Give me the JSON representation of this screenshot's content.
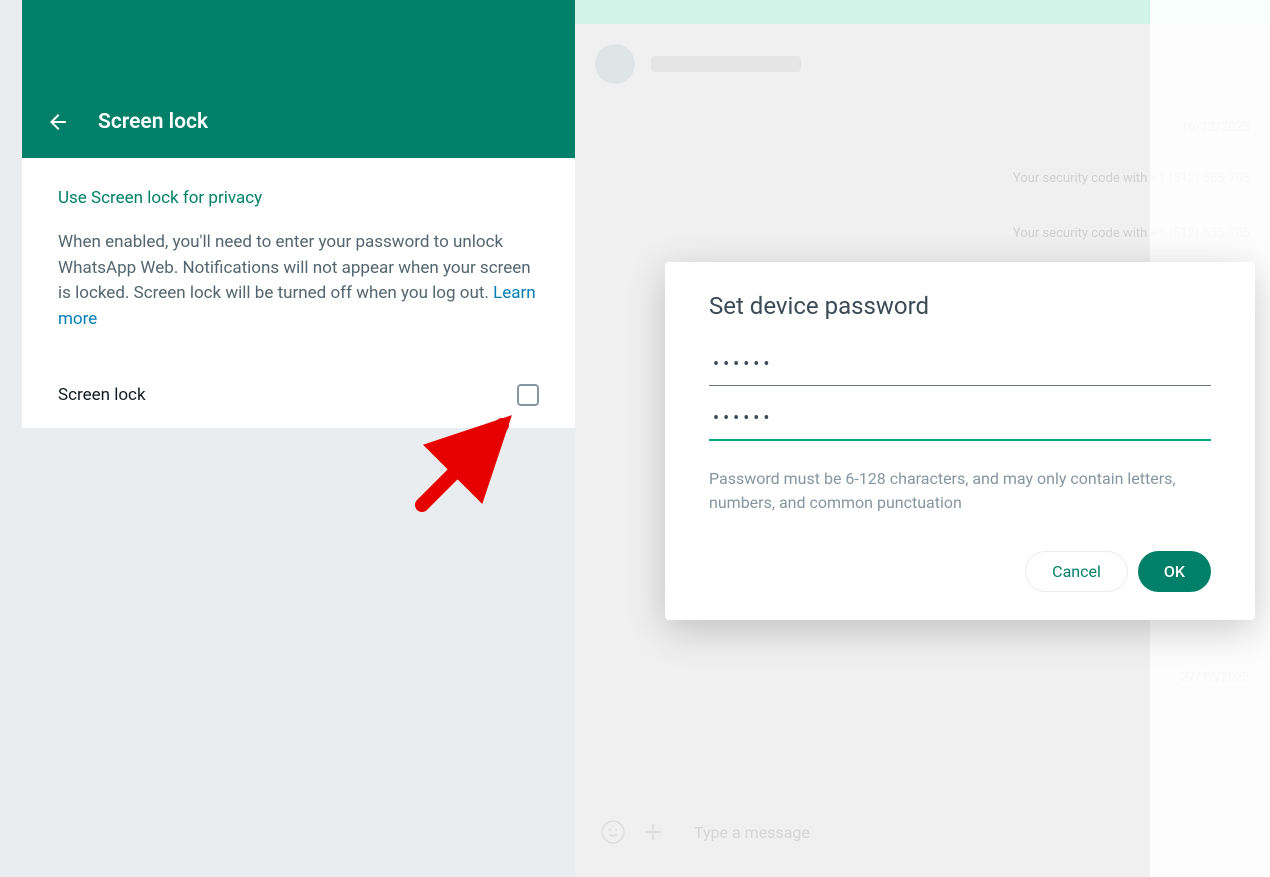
{
  "header": {
    "title": "Screen lock"
  },
  "section": {
    "title": "Use Screen lock for privacy",
    "description_part1": "When enabled, you'll need to enter your password to unlock WhatsApp Web. Notifications will not appear when your screen is locked. Screen lock will be turned off when you log out. ",
    "learn_more": "Learn more"
  },
  "toggle": {
    "label": "Screen lock"
  },
  "chat": {
    "date1": "16/12/2023",
    "date2": "27/12/2023",
    "msg1": "Your security code with +1 (512) 555-705",
    "msg2": "Your security code with +1 (512) 555-705",
    "compose_placeholder": "Type a message"
  },
  "modal": {
    "title": "Set device password",
    "password1": "••••••",
    "password2": "••••••",
    "hint": "Password must be 6-128 characters, and may only contain letters, numbers, and common punctuation",
    "cancel": "Cancel",
    "ok": "OK"
  }
}
